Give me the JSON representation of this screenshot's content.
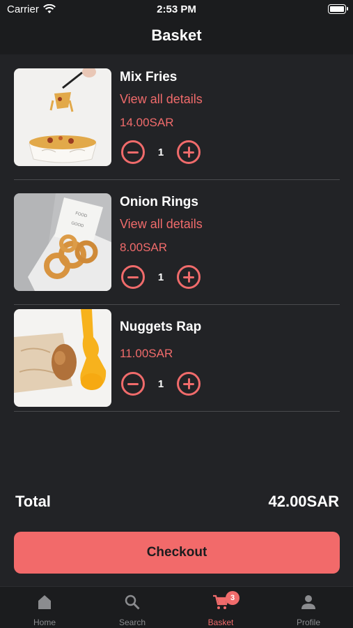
{
  "status_bar": {
    "carrier": "Carrier",
    "time": "2:53 PM"
  },
  "nav": {
    "title": "Basket"
  },
  "items": [
    {
      "name": "Mix Fries",
      "details": "View all details",
      "price": "14.00SAR",
      "qty": "1"
    },
    {
      "name": "Onion Rings",
      "details": "View all details",
      "price": "8.00SAR",
      "qty": "1"
    },
    {
      "name": "Nuggets Rap",
      "details": "",
      "price": "11.00SAR",
      "qty": "1"
    }
  ],
  "total": {
    "label": "Total",
    "value": "42.00SAR"
  },
  "checkout": {
    "label": "Checkout"
  },
  "tabs": [
    {
      "label": "Home",
      "icon": "home-icon"
    },
    {
      "label": "Search",
      "icon": "search-icon"
    },
    {
      "label": "Basket",
      "icon": "cart-icon",
      "badge": "3"
    },
    {
      "label": "Profile",
      "icon": "person-icon"
    }
  ],
  "colors": {
    "accent": "#f06b6b",
    "background": "#222326",
    "bar": "#1b1c1e"
  }
}
